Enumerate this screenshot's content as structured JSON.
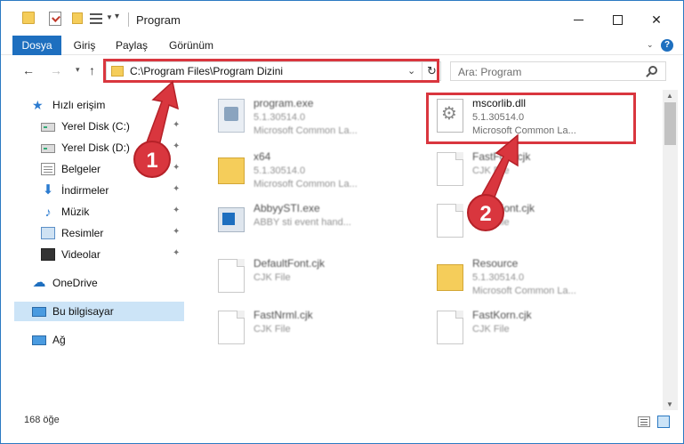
{
  "window": {
    "title": "Program"
  },
  "window_controls": {
    "minimize": "Minimize",
    "maximize": "Maximize",
    "close": "✕"
  },
  "ribbon": {
    "tabs": [
      {
        "label": "Dosya"
      },
      {
        "label": "Giriş"
      },
      {
        "label": "Paylaş"
      },
      {
        "label": "Görünüm"
      }
    ],
    "help": "?"
  },
  "navigation": {
    "back": "←",
    "forward": "→",
    "up": "↑",
    "refresh": "↻"
  },
  "address": {
    "path": "C:\\Program Files\\Program Dizini"
  },
  "search": {
    "placeholder": "Ara: Program"
  },
  "sidebar": {
    "items": [
      {
        "label": "Hızlı erişim",
        "icon": "star-icon"
      },
      {
        "label": "Yerel Disk (C:)",
        "icon": "drive-icon",
        "pinned": true
      },
      {
        "label": "Yerel Disk (D:)",
        "icon": "drive-icon",
        "pinned": true
      },
      {
        "label": "Belgeler",
        "icon": "documents-icon",
        "pinned": true
      },
      {
        "label": "İndirmeler",
        "icon": "download-icon",
        "pinned": true
      },
      {
        "label": "Müzik",
        "icon": "music-icon",
        "pinned": true
      },
      {
        "label": "Resimler",
        "icon": "pictures-icon",
        "pinned": true
      },
      {
        "label": "Videolar",
        "icon": "video-icon",
        "pinned": true
      },
      {
        "label": "OneDrive",
        "icon": "cloud-icon"
      },
      {
        "label": "Bu bilgisayar",
        "icon": "computer-icon",
        "selected": true
      },
      {
        "label": "Ağ",
        "icon": "network-icon"
      }
    ]
  },
  "files": [
    {
      "name": "program.exe",
      "line1": "5.1.30514.0",
      "line2": "Microsoft Common La...",
      "icon": "exe-icon"
    },
    {
      "name": "mscorlib.dll",
      "line1": "5.1.30514.0",
      "line2": "Microsoft Common La...",
      "icon": "dll-icon"
    },
    {
      "name": "x64",
      "line1": "5.1.30514.0",
      "line2": "Microsoft Common La...",
      "icon": "folder-icon"
    },
    {
      "name": "FastFont.cjk",
      "line1": "CJK File",
      "line2": "",
      "icon": "document-icon"
    },
    {
      "name": "AbbyySTI.exe",
      "line1": "ABBY sti event hand...",
      "line2": "",
      "icon": "app-icon"
    },
    {
      "name": "Font.cjk",
      "line1": "CJK File",
      "line2": "",
      "icon": "document-icon"
    },
    {
      "name": "DefaultFont.cjk",
      "line1": "CJK File",
      "line2": "",
      "icon": "document-icon"
    },
    {
      "name": "Resource",
      "line1": "5.1.30514.0",
      "line2": "Microsoft Common La...",
      "icon": "folder-icon"
    },
    {
      "name": "FastNrml.cjk",
      "line1": "CJK File",
      "line2": "",
      "icon": "document-icon"
    },
    {
      "name": "FastKorn.cjk",
      "line1": "CJK File",
      "line2": "",
      "icon": "document-icon"
    }
  ],
  "status": {
    "count": "168 öğe"
  },
  "annotations": {
    "step1": "1",
    "step2": "2",
    "color": "#d9363e"
  },
  "colors": {
    "accent": "#1e6fbf",
    "selection": "#cce4f7",
    "highlight": "#d9363e"
  }
}
